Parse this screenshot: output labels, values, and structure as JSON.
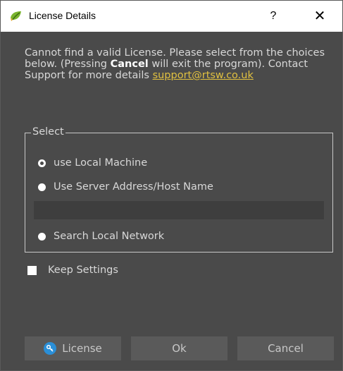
{
  "window": {
    "title": "License Details",
    "help_label": "?",
    "close_label": "✕"
  },
  "message": {
    "part1": "Cannot find a valid License. Please select from the choices below. (Pressing ",
    "bold": "Cancel",
    "part2": " will exit the program). Contact Support for more details ",
    "email": "support@rtsw.co.uk"
  },
  "select_group": {
    "title": "Select",
    "options": [
      {
        "label": "use Local Machine",
        "selected": true
      },
      {
        "label": "Use Server Address/Host Name",
        "selected": false
      },
      {
        "label": "Search Local Network",
        "selected": false
      }
    ],
    "host_input_value": "",
    "host_input_placeholder": ""
  },
  "keep_settings": {
    "label": "Keep Settings",
    "checked": false
  },
  "buttons": {
    "license": "License",
    "ok": "Ok",
    "cancel": "Cancel"
  },
  "icons": {
    "app": "leaf-logo-icon",
    "license": "key-icon"
  },
  "colors": {
    "background": "#4a4a4a",
    "text": "#d8d8d8",
    "link": "#e0c040",
    "key_icon": "#2a8fd8"
  }
}
